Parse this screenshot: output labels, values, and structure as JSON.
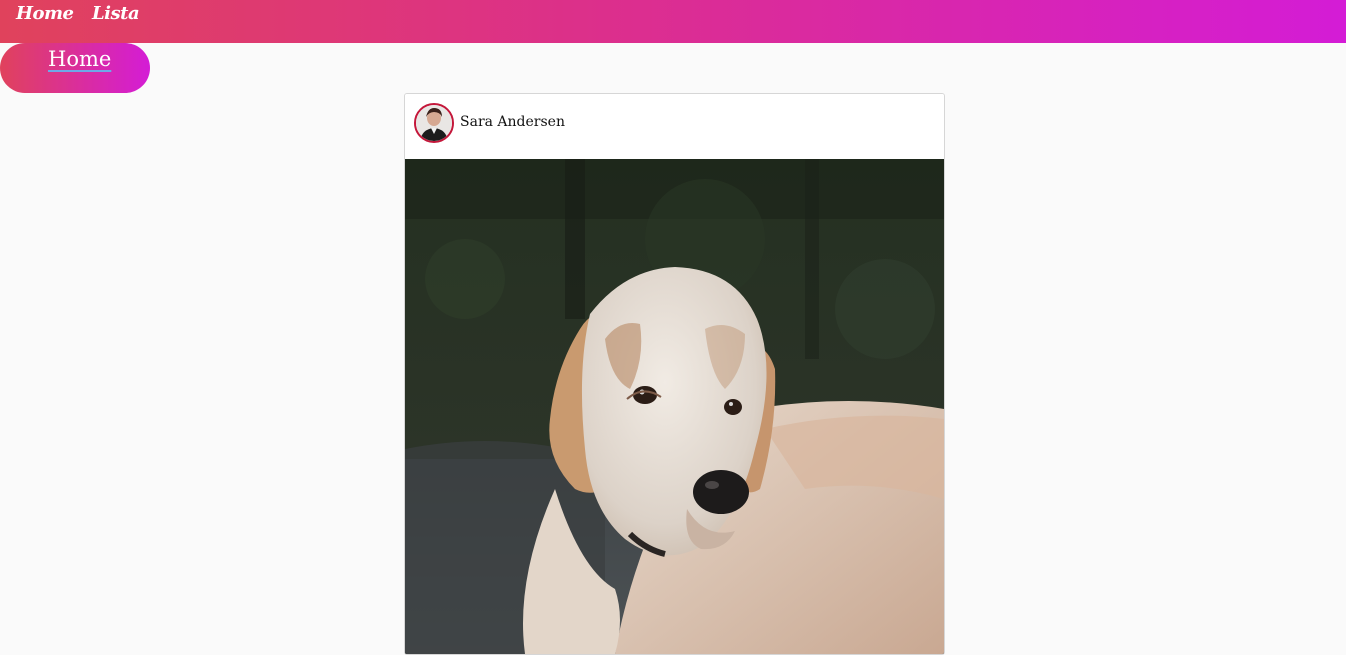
{
  "navbar": {
    "items": [
      {
        "label": "Home"
      },
      {
        "label": "Lista"
      }
    ]
  },
  "hero": {
    "link_label": "Home"
  },
  "post": {
    "author_name": "Sara Andersen",
    "avatar_icon": "user-avatar-photo",
    "image_subject": "dog-photo"
  },
  "colors": {
    "gradient_start": "#e0425c",
    "gradient_end": "#d41cd6",
    "avatar_ring": "#c4173a",
    "background": "#fafafa"
  }
}
